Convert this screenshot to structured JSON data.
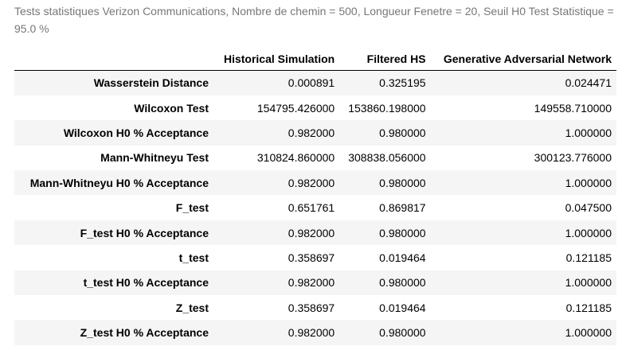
{
  "caption": "Tests statistiques Verizon Communications, Nombre de chemin = 500, Longueur Fenetre = 20, Seuil H0 Test Statistique = 95.0 %",
  "table": {
    "columns": [
      "Historical Simulation",
      "Filtered HS",
      "Generative Adversarial Network"
    ],
    "rows": [
      {
        "label": "Wasserstein Distance",
        "values": [
          "0.000891",
          "0.325195",
          "0.024471"
        ]
      },
      {
        "label": "Wilcoxon Test",
        "values": [
          "154795.426000",
          "153860.198000",
          "149558.710000"
        ]
      },
      {
        "label": "Wilcoxon H0 % Acceptance",
        "values": [
          "0.982000",
          "0.980000",
          "1.000000"
        ]
      },
      {
        "label": "Mann-Whitneyu Test",
        "values": [
          "310824.860000",
          "308838.056000",
          "300123.776000"
        ]
      },
      {
        "label": "Mann-Whitneyu H0 % Acceptance",
        "values": [
          "0.982000",
          "0.980000",
          "1.000000"
        ]
      },
      {
        "label": "F_test",
        "values": [
          "0.651761",
          "0.869817",
          "0.047500"
        ]
      },
      {
        "label": "F_test H0 % Acceptance",
        "values": [
          "0.982000",
          "0.980000",
          "1.000000"
        ]
      },
      {
        "label": "t_test",
        "values": [
          "0.358697",
          "0.019464",
          "0.121185"
        ]
      },
      {
        "label": "t_test H0 % Acceptance",
        "values": [
          "0.982000",
          "0.980000",
          "1.000000"
        ]
      },
      {
        "label": "Z_test",
        "values": [
          "0.358697",
          "0.019464",
          "0.121185"
        ]
      },
      {
        "label": "Z_test H0 % Acceptance",
        "values": [
          "0.982000",
          "0.980000",
          "1.000000"
        ]
      }
    ]
  }
}
